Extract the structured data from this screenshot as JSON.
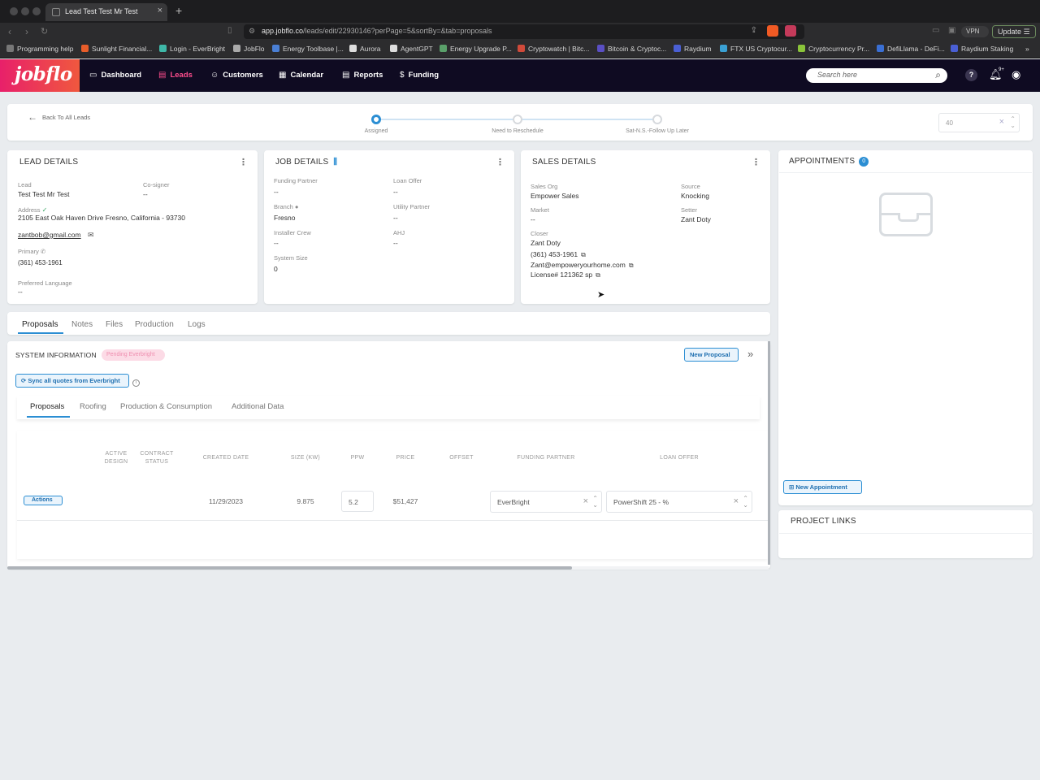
{
  "browser": {
    "tab_title": "Lead Test Test Mr Test",
    "url_domain": "app.jobflo.co",
    "url_path": "/leads/edit/22930146?perPage=5&sortBy=&tab=proposals",
    "vpn_label": "VPN",
    "update_label": "Update",
    "bookmarks": [
      {
        "label": "Programming help",
        "color": "#777777"
      },
      {
        "label": "Sunlight Financial...",
        "color": "#e85d2a"
      },
      {
        "label": "Login - EverBright",
        "color": "#3fb8a8"
      },
      {
        "label": "JobFlo",
        "color": "#aaaaaa"
      },
      {
        "label": "Energy Toolbase |...",
        "color": "#4a7fd4"
      },
      {
        "label": "Aurora",
        "color": "#dddddd"
      },
      {
        "label": "AgentGPT",
        "color": "#dddddd"
      },
      {
        "label": "Energy Upgrade P...",
        "color": "#5aa06a"
      },
      {
        "label": "Cryptowatch | Bitc...",
        "color": "#d04a3a"
      },
      {
        "label": "Bitcoin & Cryptoc...",
        "color": "#5a4fc4"
      },
      {
        "label": "Raydium",
        "color": "#4a5fd4"
      },
      {
        "label": "FTX US Cryptocur...",
        "color": "#3aa0d4"
      },
      {
        "label": "Cryptocurrency Pr...",
        "color": "#8ac43a"
      },
      {
        "label": "DefiLlama - DeFi...",
        "color": "#3a6fd4"
      },
      {
        "label": "Raydium Staking",
        "color": "#4a5fd4"
      }
    ]
  },
  "app": {
    "logo": "jobflo",
    "nav": [
      {
        "label": "Dashboard",
        "icon": "dashboard-icon"
      },
      {
        "label": "Leads",
        "icon": "leads-icon",
        "active": true
      },
      {
        "label": "Customers",
        "icon": "customers-icon"
      },
      {
        "label": "Calendar",
        "icon": "calendar-icon"
      },
      {
        "label": "Reports",
        "icon": "reports-icon"
      },
      {
        "label": "Funding",
        "icon": "funding-icon"
      }
    ],
    "search_placeholder": "Search here",
    "notification_count": "9+",
    "accent_color": "#e8206a",
    "active_nav_color": "#ff4d8d",
    "primary_color": "#2b8ed3"
  },
  "stepper": {
    "back_label": "Back To All Leads",
    "steps": [
      {
        "label": "Assigned",
        "active": true
      },
      {
        "label": "Need to Reschedule"
      },
      {
        "label": "Sat-N.S.-Follow Up Later"
      }
    ],
    "per_page_value": "40"
  },
  "lead_details": {
    "title": "LEAD DETAILS",
    "lead_label": "Lead",
    "lead_value": "Test Test Mr Test",
    "cosigner_label": "Co-signer",
    "cosigner_value": "--",
    "address_label": "Address",
    "address_value": "2105 East Oak Haven Drive Fresno, California - 93730",
    "email": "zantbob@gmail.com",
    "primary_label": "Primary",
    "phone": "(361) 453-1961",
    "language_label": "Preferred Language",
    "language_value": "--"
  },
  "job_details": {
    "title": "JOB DETAILS",
    "funding_partner_label": "Funding Partner",
    "funding_partner_value": "--",
    "loan_offer_label": "Loan Offer",
    "loan_offer_value": "--",
    "branch_label": "Branch",
    "branch_value": "Fresno",
    "utility_partner_label": "Utility Partner",
    "utility_partner_value": "--",
    "installer_crew_label": "Installer Crew",
    "installer_crew_value": "--",
    "ahj_label": "AHJ",
    "ahj_value": "--",
    "system_size_label": "System Size",
    "system_size_value": "0"
  },
  "sales_details": {
    "title": "SALES DETAILS",
    "sales_org_label": "Sales Org",
    "sales_org_value": "Empower Sales",
    "source_label": "Source",
    "source_value": "Knocking",
    "market_label": "Market",
    "market_value": "--",
    "setter_label": "Setter",
    "setter_value": "Zant Doty",
    "closer_label": "Closer",
    "closer_name": "Zant Doty",
    "closer_phone": "(361) 453-1961",
    "closer_email": "Zant@empoweryourhome.com",
    "closer_license": "License# 121362 sp"
  },
  "appointments": {
    "title": "APPOINTMENTS",
    "count": "0",
    "new_button": "New Appointment"
  },
  "project_links": {
    "title": "PROJECT LINKS"
  },
  "main_tabs": [
    "Proposals",
    "Notes",
    "Files",
    "Production",
    "Logs"
  ],
  "system_info": {
    "title": "SYSTEM INFORMATION",
    "status_pill": "Pending Everbright",
    "new_proposal": "New Proposal",
    "sync_button": "Sync all quotes from Everbright",
    "sub_tabs": [
      "Proposals",
      "Roofing",
      "Production & Consumption",
      "Additional Data"
    ]
  },
  "proposals_table": {
    "headers": {
      "active_design": [
        "ACTIVE",
        "DESIGN"
      ],
      "contract_status": [
        "CONTRACT",
        "STATUS"
      ],
      "created_date": "CREATED DATE",
      "size": "SIZE (KW)",
      "ppw": "PPW",
      "price": "PRICE",
      "offset": "OFFSET",
      "funding_partner": "FUNDING PARTNER",
      "loan_offer": "LOAN OFFER"
    },
    "row": {
      "actions_label": "Actions",
      "created_date": "11/29/2023",
      "size": "9.875",
      "ppw": "5.2",
      "price": "$51,427",
      "funding_partner": "EverBright",
      "loan_offer": "PowerShift 25 - %"
    }
  }
}
